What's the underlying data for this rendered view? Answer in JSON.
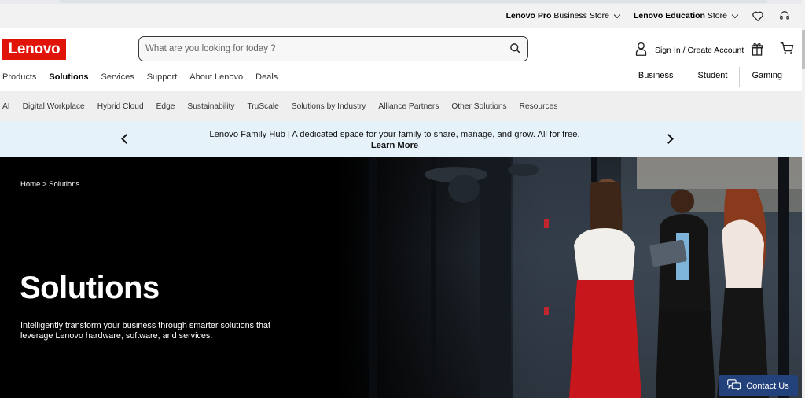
{
  "utility": {
    "pro_store_bold": "Lenovo Pro",
    "pro_store_rest": "Business Store",
    "edu_store_bold": "Lenovo Education",
    "edu_store_rest": "Store"
  },
  "header": {
    "logo_text": "Lenovo",
    "search_placeholder": "What are you looking for today ?",
    "sign_in": "Sign In / Create Account"
  },
  "main_nav": {
    "items": [
      "Products",
      "Solutions",
      "Services",
      "Support",
      "About Lenovo",
      "Deals"
    ],
    "active": "Solutions",
    "segments": [
      "Business",
      "Student",
      "Gaming"
    ]
  },
  "sub_nav": {
    "items": [
      "AI",
      "Digital Workplace",
      "Hybrid Cloud",
      "Edge",
      "Sustainability",
      "TruScale",
      "Solutions by Industry",
      "Alliance Partners",
      "Other Solutions",
      "Resources"
    ]
  },
  "promo": {
    "text": "Lenovo Family Hub | A dedicated space for your family to share, manage, and grow. All for free.",
    "link": "Learn More"
  },
  "hero": {
    "breadcrumb": "Home > Solutions",
    "title": "Solutions",
    "description": "Intelligently transform your business through smarter solutions that leverage Lenovo hardware, software, and services."
  },
  "contact": {
    "label": "Contact Us"
  },
  "colors": {
    "brand_red": "#e1140a",
    "contact_blue": "#23417a",
    "promo_bg": "#e6f2f9"
  }
}
